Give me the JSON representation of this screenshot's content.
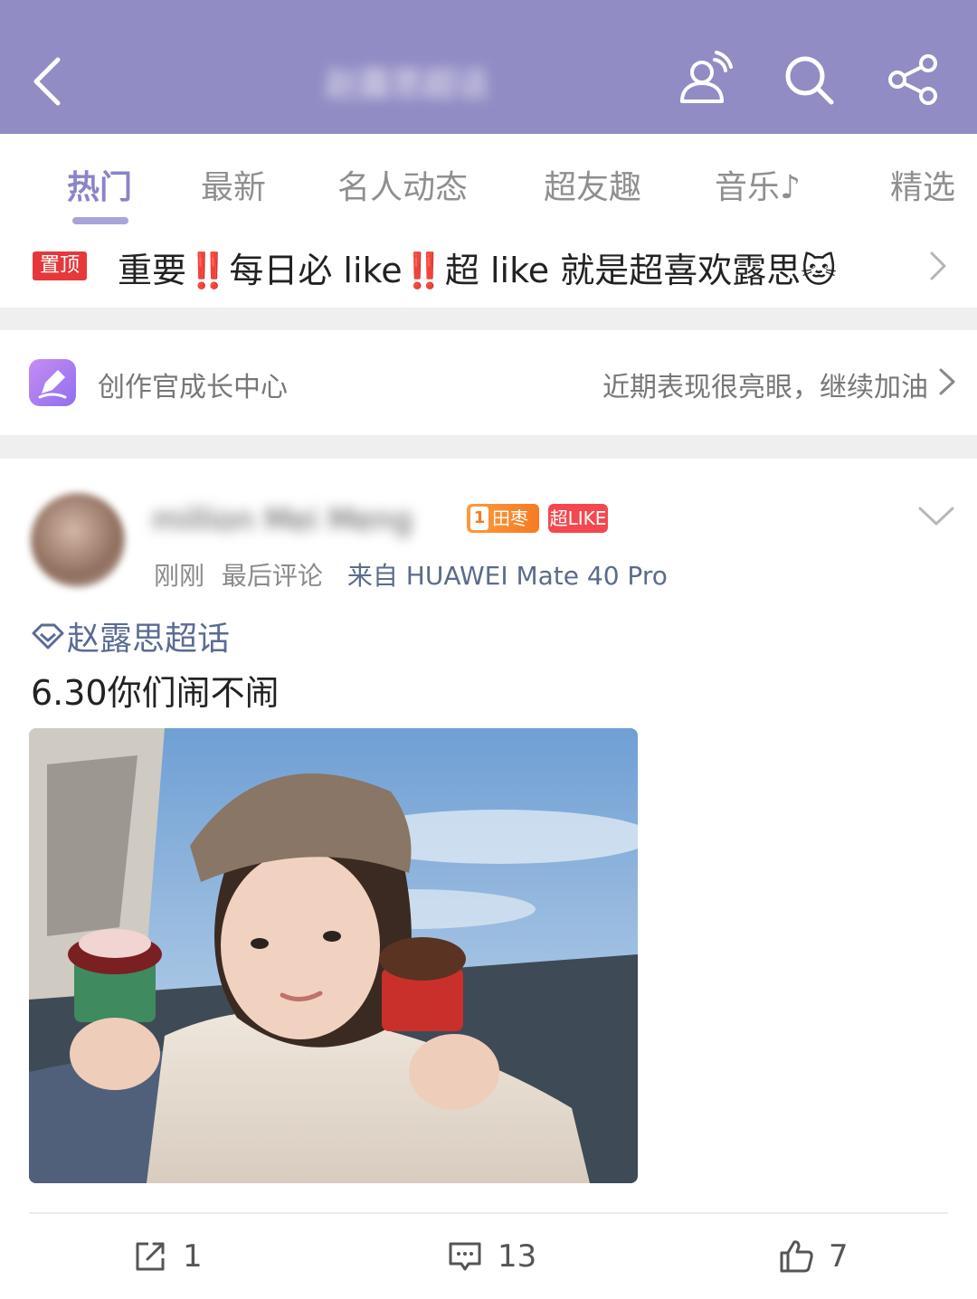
{
  "header": {
    "title": "赵露思超话",
    "bg_color": "#918cc4"
  },
  "tabs": [
    {
      "label": "热门",
      "active": true
    },
    {
      "label": "最新",
      "active": false
    },
    {
      "label": "名人动态",
      "active": false
    },
    {
      "label": "超友趣",
      "active": false
    },
    {
      "label": "音乐♪",
      "active": false
    },
    {
      "label": "精选",
      "active": false
    }
  ],
  "pinned": {
    "badge": "置顶",
    "text_1": "重要",
    "bang": "‼️",
    "text_2": "每日必 like",
    "text_3": "超 like 就是超喜欢露思",
    "emoji": "🐱"
  },
  "creator": {
    "label": "创作官成长中心",
    "hint": "近期表现很亮眼，继续加油"
  },
  "post": {
    "username": "million Mei Meng",
    "fan_badge": "田枣",
    "fan_level": "1",
    "like_badge": "超LIKE",
    "time": "刚刚",
    "last_comment": "最后评论",
    "source_prefix": "来自",
    "device": "HUAWEI Mate 40 Pro",
    "topic": "赵露思超话",
    "text": "6.30你们闹不闹",
    "actions": {
      "repost": "1",
      "comment": "13",
      "like": "7"
    }
  }
}
